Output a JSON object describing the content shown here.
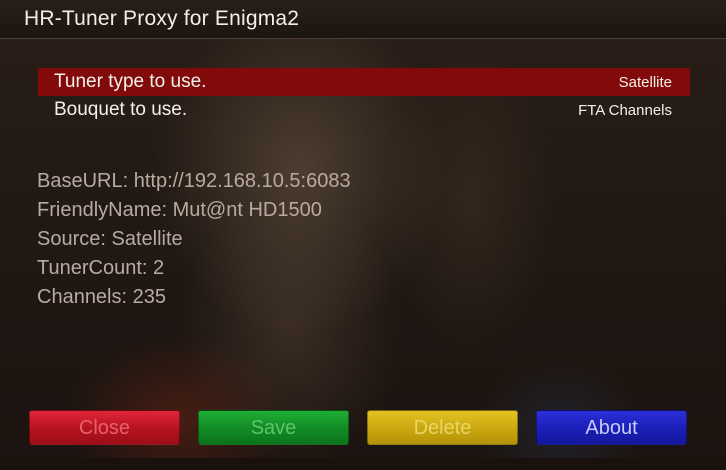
{
  "window": {
    "title": "HR-Tuner Proxy for Enigma2"
  },
  "config": {
    "items": [
      {
        "label": "Tuner type to use.",
        "value": "Satellite",
        "selected": true
      },
      {
        "label": "Bouquet to use.",
        "value": "FTA Channels",
        "selected": false
      }
    ]
  },
  "info": {
    "lines": [
      "BaseURL: http://192.168.10.5:6083",
      "FriendlyName: Mut@nt HD1500",
      "Source: Satellite",
      "TunerCount: 2",
      "Channels: 235"
    ]
  },
  "buttons": {
    "red": "Close",
    "green": "Save",
    "yellow": "Delete",
    "blue": "About"
  },
  "colors": {
    "selection": "#820a0a",
    "red_button": "#b5121f",
    "green_button": "#128a25",
    "yellow_button": "#c9a70f",
    "blue_button": "#1b1fb7"
  }
}
